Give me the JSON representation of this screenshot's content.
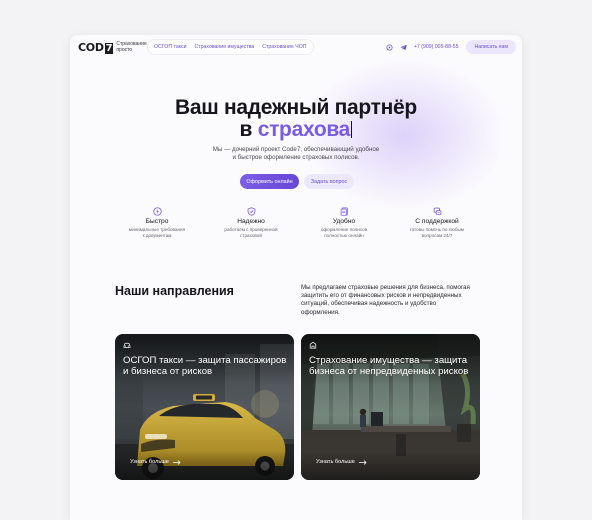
{
  "brand": {
    "logo_text": "COD",
    "logo_seven": "7",
    "tagline": "Страхование просто"
  },
  "nav": {
    "items": [
      {
        "label": "ОСГОП такси"
      },
      {
        "label": "Страхование имущества"
      },
      {
        "label": "Страхование ЧОП"
      }
    ]
  },
  "header": {
    "phone": "+7 (909) 005-88-55",
    "write_button": "Написать нам",
    "icons": [
      "whatsapp-icon",
      "telegram-icon"
    ]
  },
  "hero": {
    "title_line1": "Ваш надежный партнёр",
    "title_prefix": "в ",
    "title_accent": "страхова",
    "subtitle_line1": "Мы — дочерний проект Code7, обеспечивающий удобное",
    "subtitle_line2": "и быстрое оформление страховых полисов.",
    "primary_button": "Оформить онлайн",
    "secondary_button": "Задать вопрос"
  },
  "features": [
    {
      "icon": "lightning-icon",
      "title": "Быстро",
      "desc_line1": "минимальные требования",
      "desc_line2": "к документам"
    },
    {
      "icon": "shield-check-icon",
      "title": "Надежно",
      "desc_line1": "работаем с проверенной",
      "desc_line2": "страховой"
    },
    {
      "icon": "document-icon",
      "title": "Удобно",
      "desc_line1": "оформление полисов",
      "desc_line2": "полностью онлайн"
    },
    {
      "icon": "support-icon",
      "title": "С поддержкой",
      "desc_line1": "готовы помочь по любым",
      "desc_line2": "вопросам 24/7"
    }
  ],
  "directions": {
    "title": "Наши направления",
    "desc_lines": [
      "Мы предлагаем страховые решения для бизнеса, помогая",
      "защитить его от финансовых рисков и непредвиденных",
      "ситуаций, обеспечивая надежность и удобство",
      "оформления."
    ],
    "cards": [
      {
        "icon": "car-icon",
        "title_line1": "ОСГОП такси — защита пассажиров",
        "title_line2": "и бизнеса от рисков",
        "link": "Узнать больше"
      },
      {
        "icon": "building-icon",
        "title_line1": "Страхование имущества — защита",
        "title_line2": "бизнеса от непредвиденных рисков",
        "link": "Узнать больше"
      }
    ]
  },
  "colors": {
    "accent": "#7a5ce3",
    "accent_soft": "#ebe6fb",
    "text": "#17151c"
  }
}
